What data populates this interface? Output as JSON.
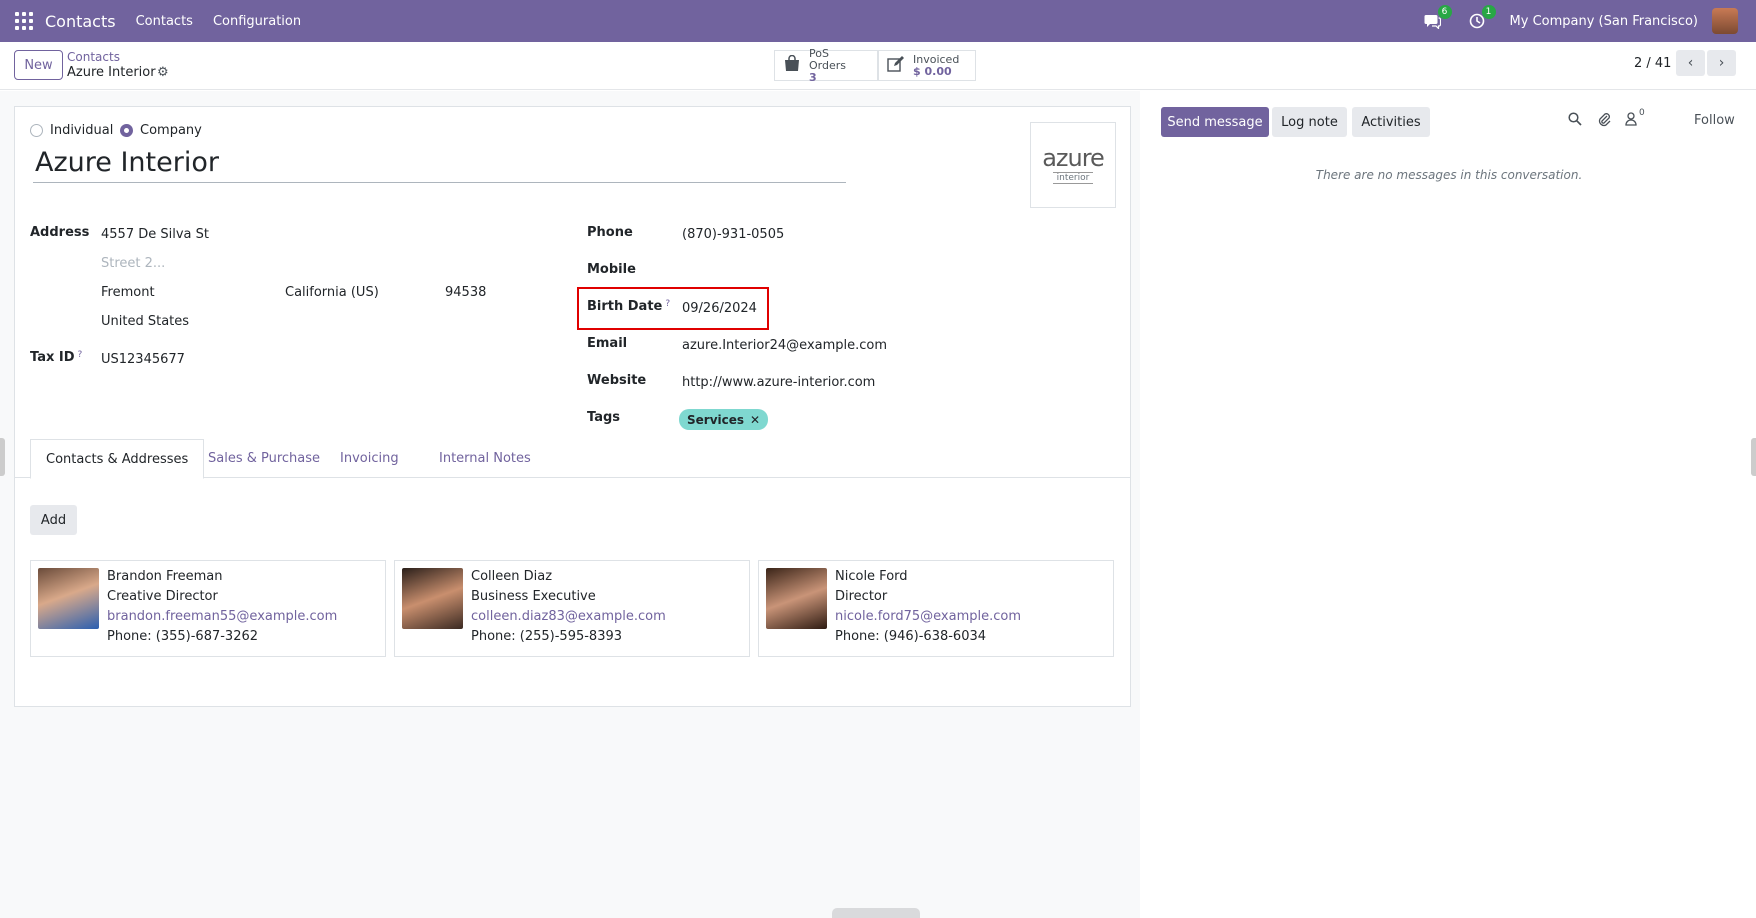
{
  "navbar": {
    "app_name": "Contacts",
    "menu": [
      "Contacts",
      "Configuration"
    ],
    "messages_badge": "6",
    "activities_badge": "1",
    "company": "My Company (San Francisco)"
  },
  "control_panel": {
    "new_label": "New",
    "breadcrumb_parent": "Contacts",
    "breadcrumb_current": "Azure Interior",
    "pos_orders_label": "PoS Orders",
    "pos_orders_value": "3",
    "invoiced_label": "Invoiced",
    "invoiced_value": "$ 0.00",
    "pager": "2 / 41"
  },
  "form": {
    "type_individual": "Individual",
    "type_company": "Company",
    "selected_type": "Company",
    "name": "Azure Interior",
    "logo_main": "azure",
    "logo_sub": "interior",
    "address_label": "Address",
    "street": "4557 De Silva St",
    "street2_placeholder": "Street 2...",
    "city": "Fremont",
    "state": "California (US)",
    "zip": "94538",
    "country": "United States",
    "tax_id_label": "Tax ID",
    "tax_id": "US12345677",
    "help_mark": "?",
    "phone_label": "Phone",
    "phone": "(870)-931-0505",
    "mobile_label": "Mobile",
    "mobile": "",
    "birth_date_label": "Birth Date",
    "birth_date": "09/26/2024",
    "email_label": "Email",
    "email": "azure.Interior24@example.com",
    "website_label": "Website",
    "website": "http://www.azure-interior.com",
    "tags_label": "Tags",
    "tag": "Services"
  },
  "tabs": [
    "Contacts & Addresses",
    "Sales & Purchase",
    "Invoicing",
    "Internal Notes"
  ],
  "add_label": "Add",
  "contacts": [
    {
      "name": "Brandon Freeman",
      "title": "Creative Director",
      "email": "brandon.freeman55@example.com",
      "phone": "Phone: (355)-687-3262"
    },
    {
      "name": "Colleen Diaz",
      "title": "Business Executive",
      "email": "colleen.diaz83@example.com",
      "phone": "Phone: (255)-595-8393"
    },
    {
      "name": "Nicole Ford",
      "title": "Director",
      "email": "nicole.ford75@example.com",
      "phone": "Phone: (946)-638-6034"
    }
  ],
  "chatter": {
    "send_message": "Send message",
    "log_note": "Log note",
    "activities": "Activities",
    "followers_count": "0",
    "follow": "Follow",
    "no_messages": "There are no messages in this conversation."
  },
  "colors": {
    "brand": "#71639e",
    "highlight": "#e00000",
    "tag": "#7fd8d0"
  }
}
